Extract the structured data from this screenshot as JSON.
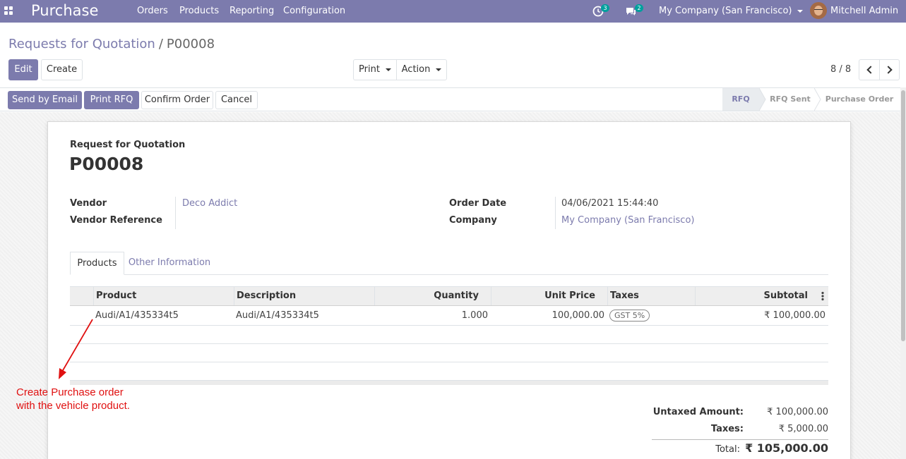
{
  "navbar": {
    "brand": "Purchase",
    "menu": [
      "Orders",
      "Products",
      "Reporting",
      "Configuration"
    ],
    "activity_badge": "3",
    "messages_badge": "2",
    "company": "My Company (San Francisco)",
    "user": "Mitchell Admin",
    "accent_color": "#7c7bad"
  },
  "breadcrumb": {
    "parent": "Requests for Quotation",
    "separator": "/",
    "current": "P00008"
  },
  "actions": {
    "edit": "Edit",
    "create": "Create",
    "print": "Print",
    "action": "Action"
  },
  "pager": {
    "value": "8 / 8"
  },
  "statusbar": {
    "buttons": [
      "Send by Email",
      "Print RFQ",
      "Confirm Order",
      "Cancel"
    ],
    "stages": [
      "RFQ",
      "RFQ Sent",
      "Purchase Order"
    ],
    "active_stage": "RFQ"
  },
  "form": {
    "subtitle": "Request for Quotation",
    "name": "P00008",
    "vendor_label": "Vendor",
    "vendor_value": "Deco Addict",
    "vendor_ref_label": "Vendor Reference",
    "vendor_ref_value": "",
    "order_date_label": "Order Date",
    "order_date_value": "04/06/2021 15:44:40",
    "company_label": "Company",
    "company_value": "My Company (San Francisco)"
  },
  "tabs": [
    "Products",
    "Other Information"
  ],
  "order_lines": {
    "columns": [
      "Product",
      "Description",
      "Quantity",
      "Unit Price",
      "Taxes",
      "Subtotal"
    ],
    "rows": [
      {
        "product": "Audi/A1/435334t5",
        "description": "Audi/A1/435334t5",
        "quantity": "1.000",
        "unit_price": "100,000.00",
        "taxes": "GST 5%",
        "subtotal": "₹ 100,000.00"
      }
    ]
  },
  "totals": {
    "untaxed_label": "Untaxed Amount:",
    "untaxed_value": "₹ 100,000.00",
    "taxes_label": "Taxes:",
    "taxes_value": "₹ 5,000.00",
    "total_label": "Total:",
    "total_value": "₹ 105,000.00"
  },
  "annotation": {
    "line1": "Create Purchase order",
    "line2": "with the vehicle product.",
    "color": "#e01010"
  }
}
